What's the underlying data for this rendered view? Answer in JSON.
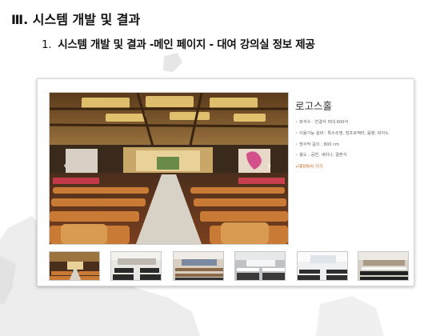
{
  "slide": {
    "title": "Ⅲ. 시스템 개발 및 결과",
    "subtitle_number": "1.",
    "subtitle": "시스템 개발 및 결과 -메인 페이지 - 대여 강의실 정보 제공"
  },
  "room": {
    "name": "로고스홀",
    "specs": [
      "좌석수 : 연결석 최대 600석",
      "이용가능 설비 : 특수조명, 빔프로젝터, 음향, 피아노",
      "방수막 길이 : 800 cm",
      "용도 : 공연, 세미나, 결혼식"
    ],
    "bullet": "•",
    "reserve_link": "대여하러 가기"
  },
  "carousel": {
    "prev_icon": "chevron-left-icon",
    "next_icon": "chevron-right-icon",
    "thumbnail_count": 6
  },
  "colors": {
    "link": "#c8661c",
    "seat_orange": "#c97a35",
    "stage_wood": "#b48a4a"
  }
}
